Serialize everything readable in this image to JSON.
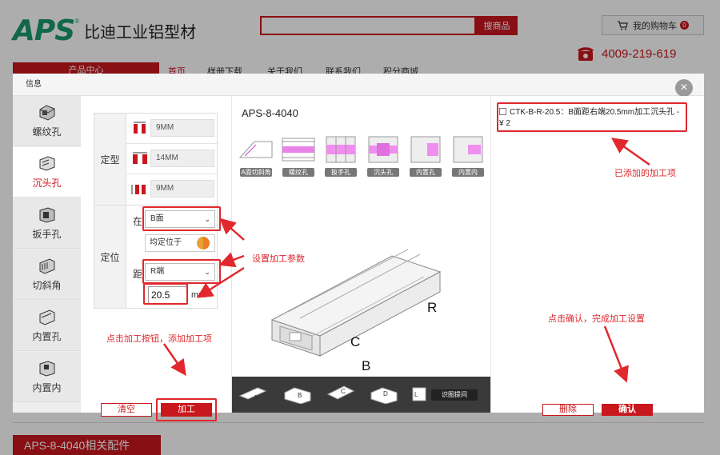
{
  "site": {
    "logo": "APS",
    "logo_reg": "®",
    "company": "比迪工业铝型材",
    "search_button": "搜商品",
    "cart_label": "我的购物车",
    "cart_count": "0",
    "phone": "4009-219-619",
    "nav": [
      "产品中心",
      "首页",
      "样册下载",
      "关于我们",
      "联系我们",
      "积分商城"
    ],
    "related_title": "APS-8-4040相关配件"
  },
  "modal": {
    "title": "信息",
    "close": "×",
    "types": [
      "螺纹孔",
      "沉头孔",
      "扳手孔",
      "切斜角",
      "内置孔",
      "内置内"
    ],
    "active_type": "沉头孔",
    "params": {
      "group_shape": "定型",
      "group_position": "定位",
      "dims": [
        "9MM",
        "14MM",
        "9MM"
      ],
      "on_label": "在",
      "on_value": "B面",
      "align_label": "均定位于",
      "dist_label": "距",
      "dist_value": "R端",
      "dist_number": "20.5",
      "unit": "mm",
      "btn_clear": "清空",
      "btn_add": "加工"
    },
    "viewer": {
      "title": "APS-8-4040",
      "thumbs": [
        "A面切斜角",
        "螺纹孔",
        "扳手孔",
        "沉头孔",
        "内置孔",
        "内置内"
      ],
      "axis_R": "R",
      "axis_L": "L",
      "face_B": "B",
      "face_C": "C",
      "faces": [
        "A",
        "B",
        "C",
        "D",
        "L"
      ],
      "identify": "识图提问"
    },
    "list": {
      "item": "CTK-B-R-20.5：B面距右端20.5mm加工沉头孔 - ¥ 2",
      "btn_delete": "删除",
      "btn_confirm": "确认"
    }
  },
  "annotations": {
    "added_items": "已添加的加工项",
    "set_params": "设置加工参数",
    "click_add": "点击加工按钮，添加加工项",
    "click_confirm": "点击确认，完成加工设置"
  },
  "colors": {
    "brand_red": "#c9171e",
    "annot_red": "#e0282e",
    "logo_green": "#1a9a6c"
  }
}
